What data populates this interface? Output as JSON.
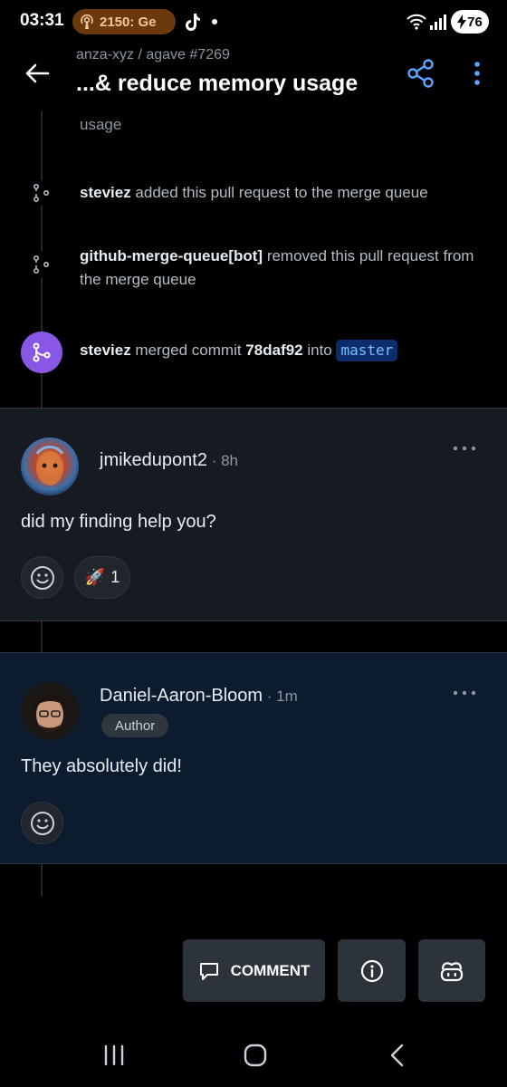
{
  "status_bar": {
    "time": "03:31",
    "pill_text": "2150: Ge",
    "battery": "76",
    "icons": [
      "podcast-icon",
      "tiktok-icon",
      "wifi-icon",
      "signal-icon",
      "battery-charging-icon"
    ]
  },
  "header": {
    "repo": "anza-xyz / agave #7269",
    "title": "...& reduce memory usage"
  },
  "timeline": {
    "clipped_text": "usage",
    "events": [
      {
        "actor": "steviez",
        "text": " added this pull request to the merge queue"
      },
      {
        "actor": "github-merge-queue[bot]",
        "text": " removed this pull request from the merge queue"
      }
    ],
    "merge": {
      "actor": "steviez",
      "text1": " merged commit ",
      "commit": "78daf92",
      "text2": " into ",
      "branch": "master"
    }
  },
  "comments": [
    {
      "author": "jmikedupont2",
      "time": " · 8h",
      "body": "did my finding help you?",
      "reactions": [
        {
          "emoji": "🚀",
          "count": "1"
        }
      ]
    },
    {
      "author": "Daniel-Aaron-Bloom",
      "time": " · 1m",
      "badge": "Author",
      "body": "They absolutely did!"
    }
  ],
  "actions": {
    "comment_label": "COMMENT"
  },
  "colors": {
    "merge_purple": "#8957e5",
    "branch_bg": "#0c2d6b",
    "branch_text": "#79c0ff",
    "accent_blue": "#58a6ff",
    "author_card_bg": "#0d1b2e"
  }
}
